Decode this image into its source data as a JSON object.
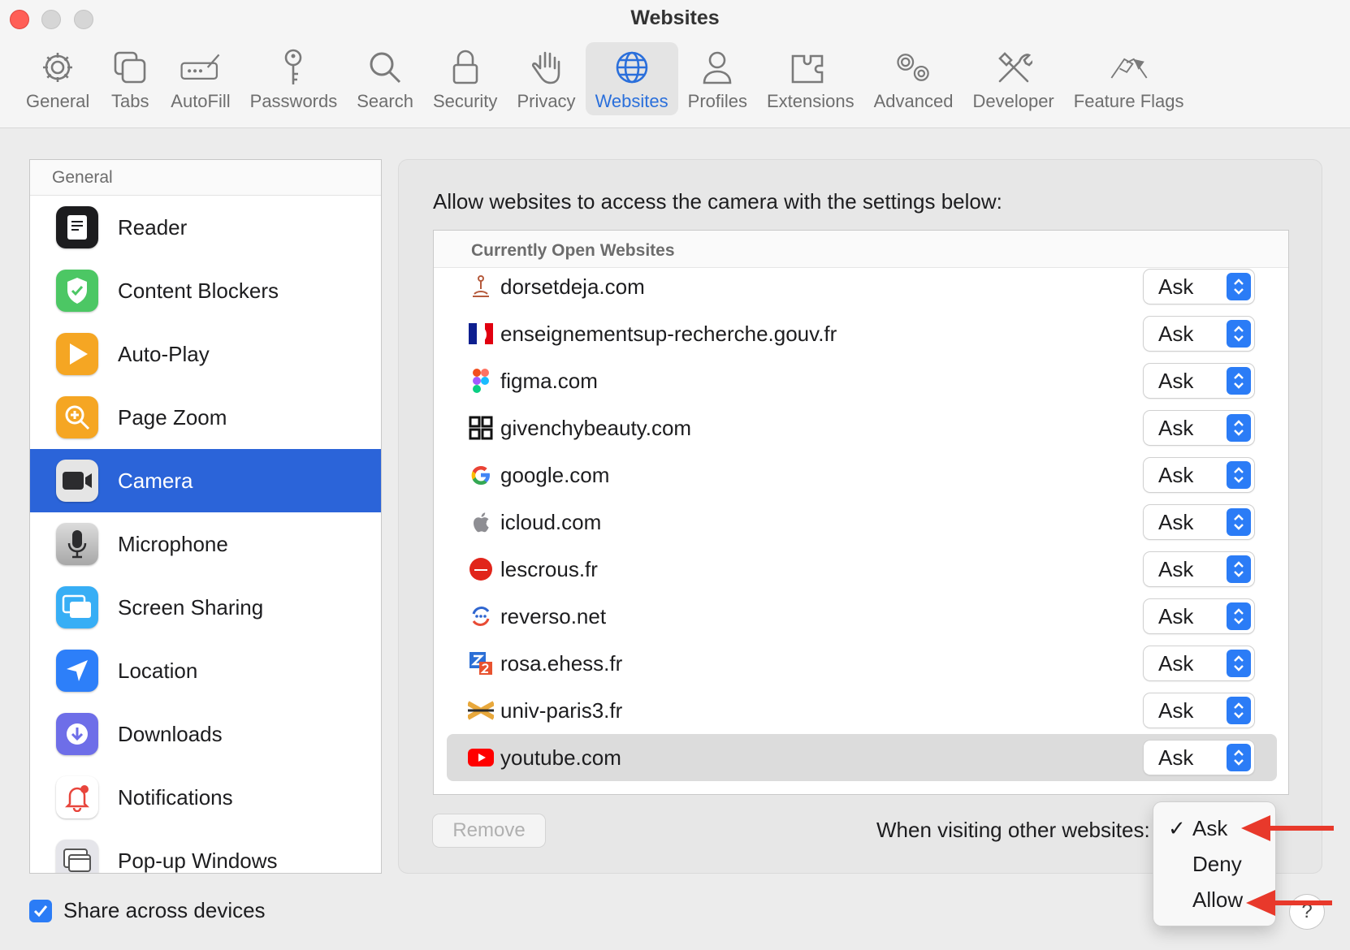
{
  "window": {
    "title": "Websites"
  },
  "toolbar": {
    "items": [
      {
        "label": "General",
        "icon": "gear-icon"
      },
      {
        "label": "Tabs",
        "icon": "tabs-icon"
      },
      {
        "label": "AutoFill",
        "icon": "autofill-icon"
      },
      {
        "label": "Passwords",
        "icon": "key-icon"
      },
      {
        "label": "Search",
        "icon": "search-icon"
      },
      {
        "label": "Security",
        "icon": "lock-icon"
      },
      {
        "label": "Privacy",
        "icon": "hand-icon"
      },
      {
        "label": "Websites",
        "icon": "globe-icon",
        "active": true
      },
      {
        "label": "Profiles",
        "icon": "person-icon"
      },
      {
        "label": "Extensions",
        "icon": "puzzle-icon"
      },
      {
        "label": "Advanced",
        "icon": "gears-icon"
      },
      {
        "label": "Developer",
        "icon": "tools-icon"
      },
      {
        "label": "Feature Flags",
        "icon": "flags-icon"
      }
    ]
  },
  "sidebar": {
    "header": "General",
    "items": [
      {
        "label": "Reader",
        "icon": "reader-icon",
        "color": "#1c1c1e"
      },
      {
        "label": "Content Blockers",
        "icon": "shield-check-icon",
        "color": "#4cc764"
      },
      {
        "label": "Auto-Play",
        "icon": "play-icon",
        "color": "#f5a623"
      },
      {
        "label": "Page Zoom",
        "icon": "zoom-icon",
        "color": "#f5a623"
      },
      {
        "label": "Camera",
        "icon": "camera-icon",
        "color": "#3a3a3c",
        "selected": true
      },
      {
        "label": "Microphone",
        "icon": "microphone-icon",
        "color": "#8e8e93"
      },
      {
        "label": "Screen Sharing",
        "icon": "screen-sharing-icon",
        "color": "#37aef5"
      },
      {
        "label": "Location",
        "icon": "location-icon",
        "color": "#2d7ff9"
      },
      {
        "label": "Downloads",
        "icon": "download-icon",
        "color": "#6e6ee8"
      },
      {
        "label": "Notifications",
        "icon": "bell-icon",
        "color": "#ffffff"
      },
      {
        "label": "Pop-up Windows",
        "icon": "popup-window-icon",
        "color": "#e5e5ea"
      }
    ],
    "share_label": "Share across devices",
    "share_checked": true
  },
  "main": {
    "heading": "Allow websites to access the camera with the settings below:",
    "table_header": "Currently Open Websites",
    "rows": [
      {
        "site": "dorsetdeja.com",
        "value": "Ask",
        "icon": "dorsetdeja-favicon"
      },
      {
        "site": "enseignementsup-recherche.gouv.fr",
        "value": "Ask",
        "icon": "marianne-favicon"
      },
      {
        "site": "figma.com",
        "value": "Ask",
        "icon": "figma-favicon"
      },
      {
        "site": "givenchybeauty.com",
        "value": "Ask",
        "icon": "givenchy-favicon"
      },
      {
        "site": "google.com",
        "value": "Ask",
        "icon": "google-favicon"
      },
      {
        "site": "icloud.com",
        "value": "Ask",
        "icon": "apple-favicon"
      },
      {
        "site": "lescrous.fr",
        "value": "Ask",
        "icon": "crous-favicon"
      },
      {
        "site": "reverso.net",
        "value": "Ask",
        "icon": "reverso-favicon"
      },
      {
        "site": "rosa.ehess.fr",
        "value": "Ask",
        "icon": "rosa-favicon"
      },
      {
        "site": "univ-paris3.fr",
        "value": "Ask",
        "icon": "paris3-favicon"
      },
      {
        "site": "youtube.com",
        "value": "Ask",
        "icon": "youtube-favicon",
        "highlighted": true
      }
    ],
    "remove_label": "Remove",
    "other_label": "When visiting other websites:",
    "other_menu": {
      "options": [
        "Ask",
        "Deny",
        "Allow"
      ],
      "checked": "Ask",
      "check_mark": "✓"
    }
  },
  "help_label": "?",
  "colors": {
    "accent": "#2b64d9",
    "annotation_arrow": "#e8392b"
  }
}
